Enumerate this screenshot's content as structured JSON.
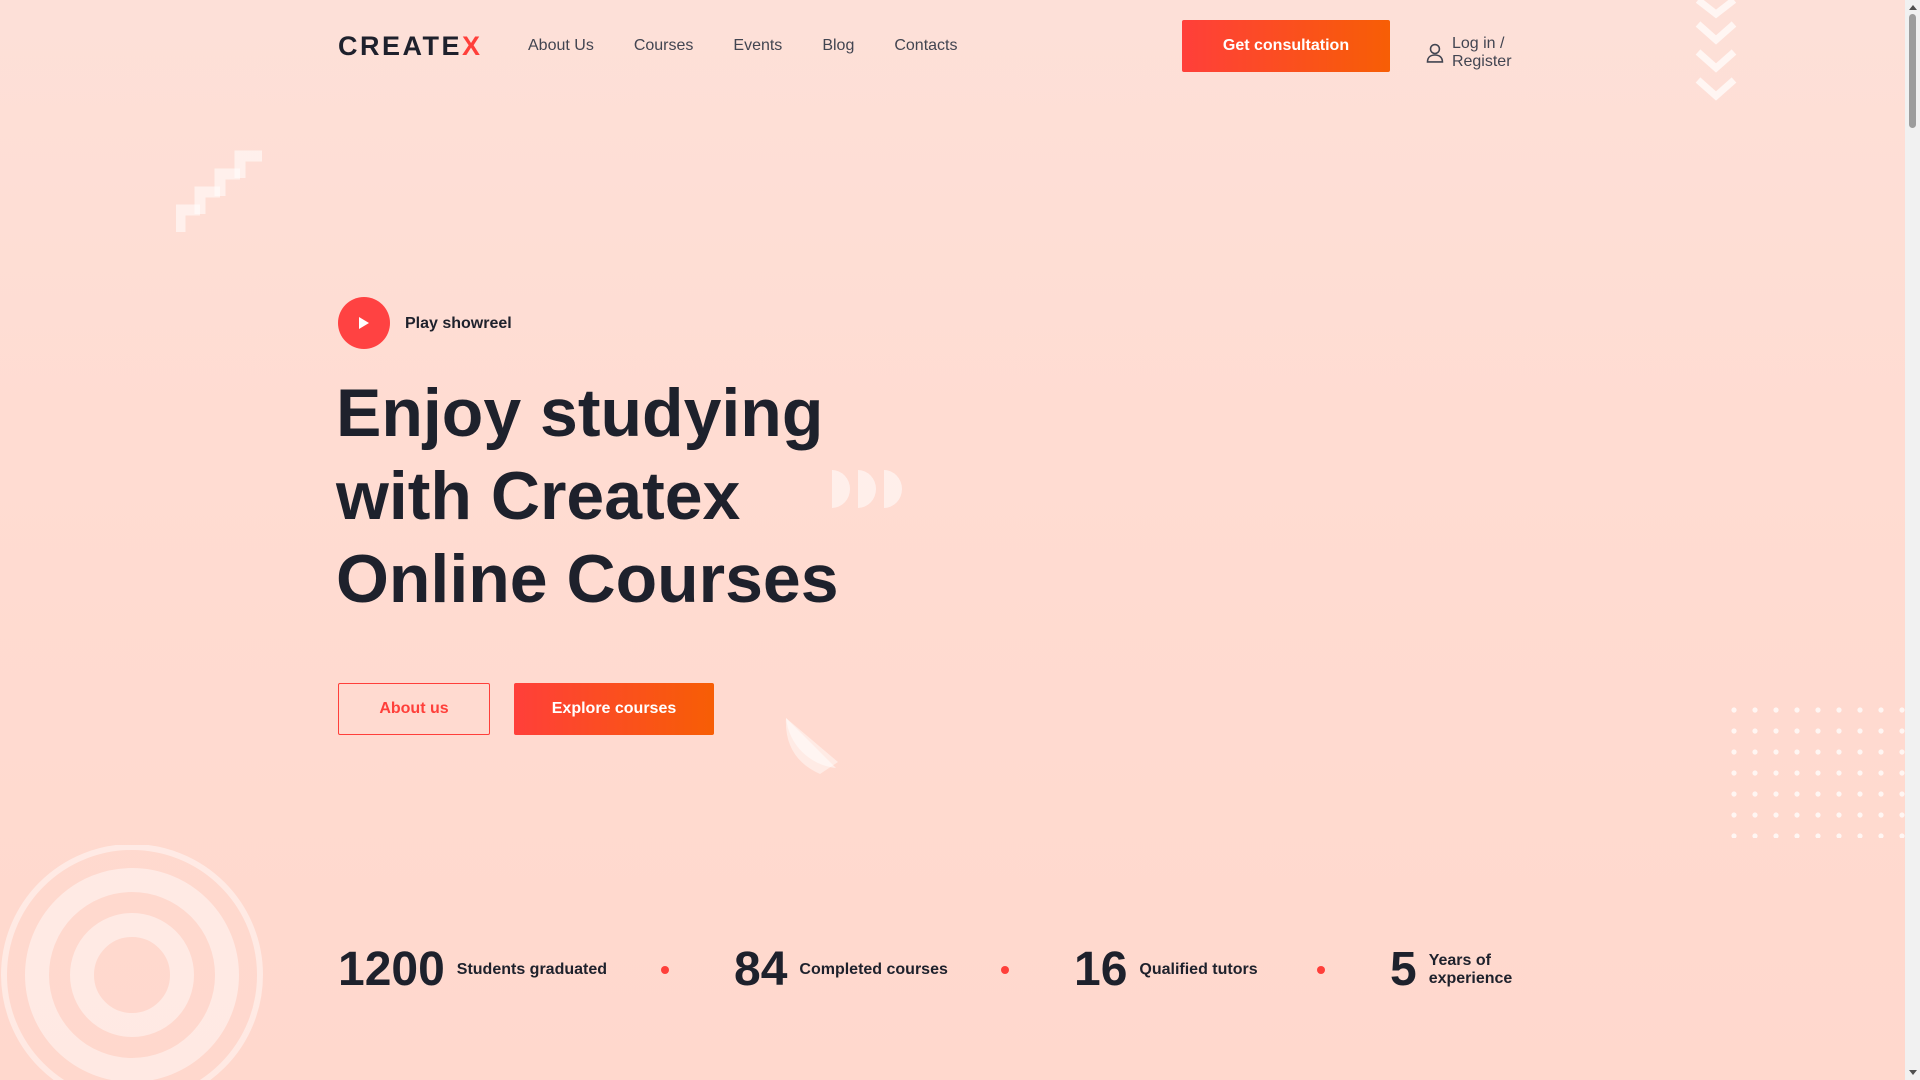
{
  "brand": {
    "logo_main": "CREATE",
    "logo_accent": "X"
  },
  "nav": {
    "items": [
      {
        "label": "About Us"
      },
      {
        "label": "Courses"
      },
      {
        "label": "Events"
      },
      {
        "label": "Blog"
      },
      {
        "label": "Contacts"
      }
    ]
  },
  "header": {
    "consult_label": "Get consultation",
    "login_label": "Log in / Register"
  },
  "hero": {
    "play_label": "Play showreel",
    "title_lines": [
      "Enjoy studying",
      "with Createx",
      "Online Courses"
    ],
    "about_btn": "About us",
    "explore_btn": "Explore courses"
  },
  "stats": [
    {
      "number": "1200",
      "label": "Students graduated"
    },
    {
      "number": "84",
      "label": "Completed courses"
    },
    {
      "number": "16",
      "label": "Qualified tutors"
    },
    {
      "number": "5",
      "label": "Years of experience"
    }
  ],
  "colors": {
    "accent": "#ff3f3a",
    "accent_gradient_end": "#f75e05",
    "text_dark": "#1e212c",
    "background": "#ffdcd2"
  },
  "icons": {
    "play": "play-icon",
    "user": "user-icon",
    "scroll_up": "chevron-up-icon",
    "scroll_down": "chevron-down-icon"
  }
}
